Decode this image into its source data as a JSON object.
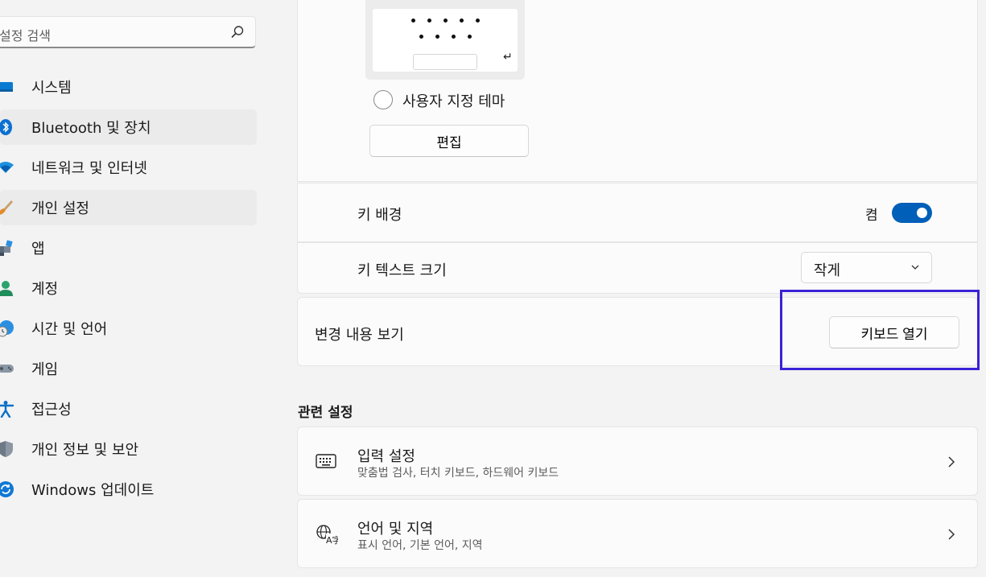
{
  "search": {
    "placeholder": "설정 검색"
  },
  "sidebar": {
    "items": [
      {
        "label": "시스템",
        "icon": "system-icon",
        "selected": false
      },
      {
        "label": "Bluetooth 및 장치",
        "icon": "bluetooth-icon",
        "selected": true
      },
      {
        "label": "네트워크 및 인터넷",
        "icon": "wifi-icon",
        "selected": false
      },
      {
        "label": "개인 설정",
        "icon": "paintbrush-icon",
        "selected": true
      },
      {
        "label": "앱",
        "icon": "apps-icon",
        "selected": false
      },
      {
        "label": "계정",
        "icon": "account-icon",
        "selected": false
      },
      {
        "label": "시간 및 언어",
        "icon": "globe-clock-icon",
        "selected": false
      },
      {
        "label": "게임",
        "icon": "gamepad-icon",
        "selected": false
      },
      {
        "label": "접근성",
        "icon": "accessibility-icon",
        "selected": false
      },
      {
        "label": "개인 정보 및 보안",
        "icon": "shield-icon",
        "selected": false
      },
      {
        "label": "Windows 업데이트",
        "icon": "update-icon",
        "selected": false
      }
    ]
  },
  "theme": {
    "custom_label": "사용자 지정 테마",
    "edit_label": "편집",
    "enter_glyph": "↵"
  },
  "key_background": {
    "label": "키 배경",
    "state": "켬",
    "on": true
  },
  "key_text_size": {
    "label": "키 텍스트 크기",
    "value": "작게"
  },
  "view_changes": {
    "label": "변경 내용 보기",
    "button": "키보드 열기"
  },
  "related": {
    "title": "관련 설정",
    "items": [
      {
        "title": "입력 설정",
        "subtitle": "맞춤법 검사, 터치 키보드, 하드웨어 키보드",
        "icon": "keyboard-icon"
      },
      {
        "title": "언어 및 지역",
        "subtitle": "표시 언어, 기본 언어, 지역",
        "icon": "language-icon"
      }
    ]
  },
  "colors": {
    "accent": "#005fb8",
    "highlight": "#3a22d6"
  }
}
